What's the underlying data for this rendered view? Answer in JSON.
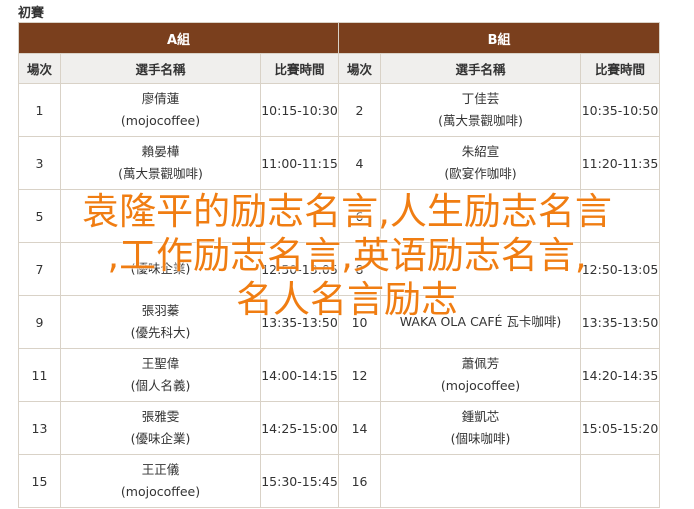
{
  "page_heading": "初賽",
  "groups": [
    {
      "label": "A組"
    },
    {
      "label": "B組"
    }
  ],
  "columns": [
    "場次",
    "選手名稱",
    "比賽時間"
  ],
  "groupA": [
    {
      "match": "1",
      "player": "廖倩蓮",
      "team": "(mojocoffee)",
      "time": "10:15-10:30"
    },
    {
      "match": "3",
      "player": "賴晏樺",
      "team": "(萬大景觀咖啡)",
      "time": "11:00-11:15"
    },
    {
      "match": "5",
      "player": "",
      "team": "",
      "time": ""
    },
    {
      "match": "7",
      "player": "",
      "team": "(優味企業)",
      "time": "12:50-13:05"
    },
    {
      "match": "9",
      "player": "張羽蓁",
      "team": "(優先科大)",
      "time": "13:35-13:50"
    },
    {
      "match": "11",
      "player": "王聖偉",
      "team": "(個人名義)",
      "time": "14:00-14:15"
    },
    {
      "match": "13",
      "player": "張雅雯",
      "team": "(優味企業)",
      "time": "14:25-15:00"
    },
    {
      "match": "15",
      "player": "王正儀",
      "team": "(mojocoffee)",
      "time": "15:30-15:45"
    }
  ],
  "groupB": [
    {
      "match": "2",
      "player": "丁佳芸",
      "team": "(萬大景觀咖啡)",
      "time": "10:35-10:50"
    },
    {
      "match": "4",
      "player": "朱紹宣",
      "team": "(歐宴作咖啡)",
      "time": "11:20-11:35"
    },
    {
      "match": "6",
      "player": "",
      "team": "",
      "time": ""
    },
    {
      "match": "8",
      "player": "",
      "team": "",
      "time": "12:50-13:05"
    },
    {
      "match": "10",
      "player": "",
      "team": "WAKA OLA CAFÉ 瓦卡咖啡)",
      "time": "13:35-13:50"
    },
    {
      "match": "12",
      "player": "蕭佩芳",
      "team": "(mojocoffee)",
      "time": "14:20-14:35"
    },
    {
      "match": "14",
      "player": "鍾凱芯",
      "team": "(個味咖啡)",
      "time": "15:05-15:20"
    },
    {
      "match": "16",
      "player": "",
      "team": "",
      "time": ""
    }
  ],
  "watermark": {
    "line1": "袁隆平的励志名言,人生励志名言",
    "line2": ",工作励志名言,英语励志名言,",
    "line3": "名人名言励志"
  },
  "colors": {
    "header_bg": "#7a3f1d",
    "subheader_bg": "#f0efed",
    "watermark": "#f07d12"
  }
}
